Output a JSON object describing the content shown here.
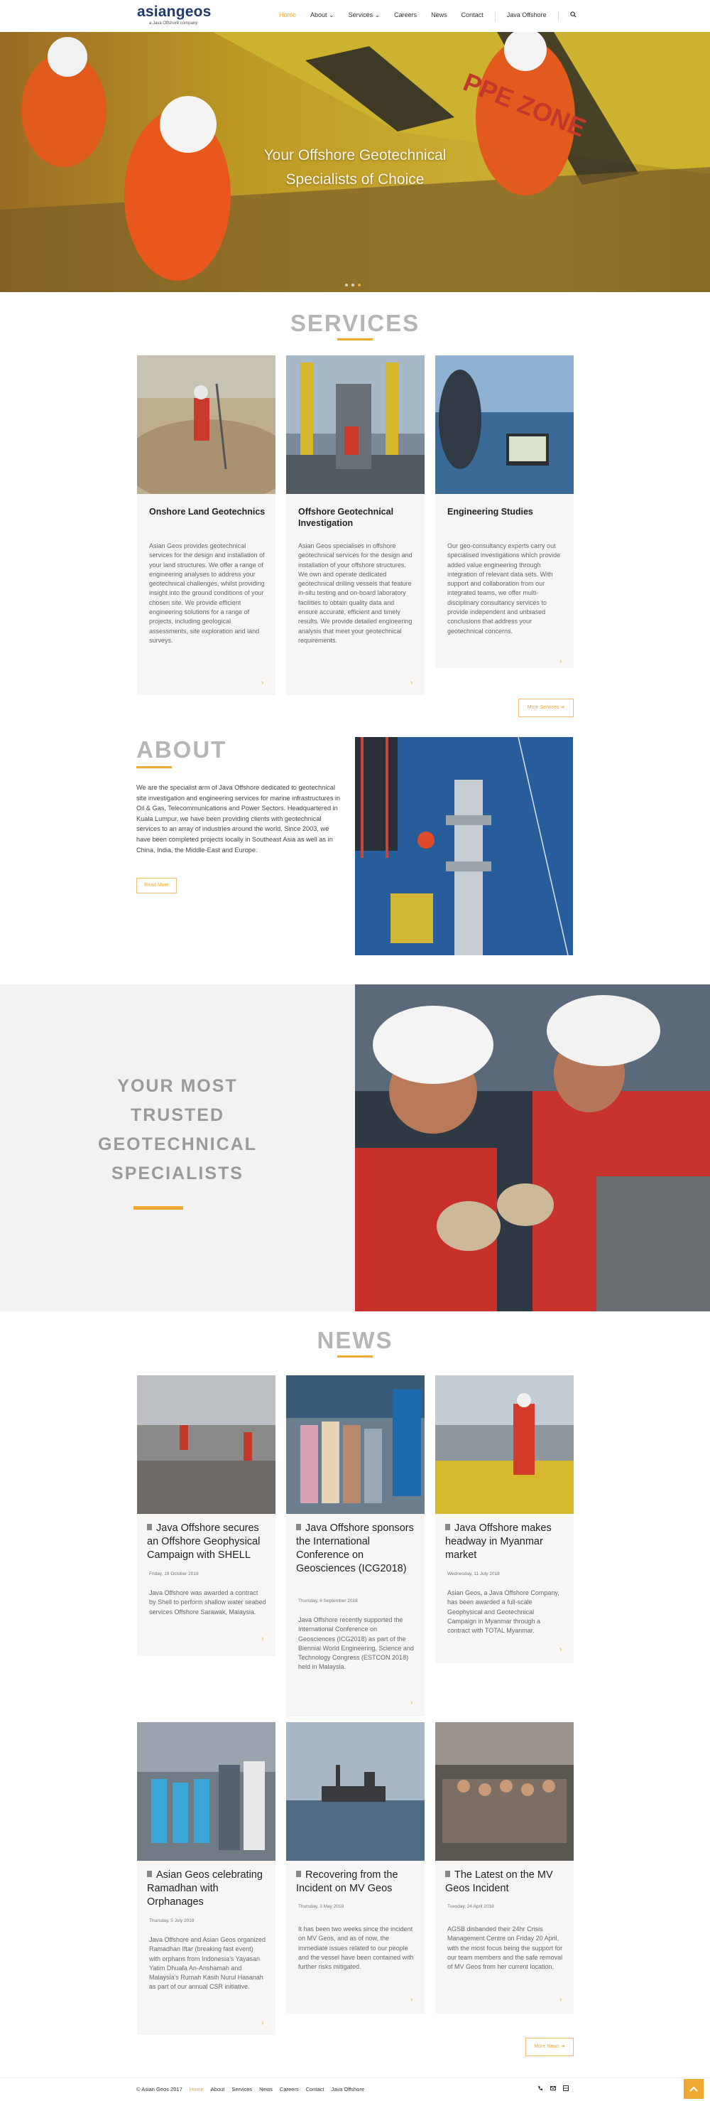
{
  "header": {
    "logo": "asiangeos",
    "tagline": "a Java Offshore company",
    "nav": [
      {
        "label": "Home"
      },
      {
        "label": "About ⌄"
      },
      {
        "label": "Services ⌄"
      },
      {
        "label": "Careers"
      },
      {
        "label": "News"
      },
      {
        "label": "Contact"
      },
      {
        "label": "Java Offshore"
      }
    ],
    "search_icon": "search-icon"
  },
  "hero": {
    "title_line1": "Your Offshore Geotechnical",
    "title_line2": "Specialists of Choice"
  },
  "services": {
    "title": "SERVICES",
    "cards": [
      {
        "title": "Onshore Land Geotechnics",
        "text": "Asian Geos provides geotechnical services for the design and installation of your land structures. We offer a range of engineering analyses to address your geotechnical challenges, whilst providing insight into the ground conditions of your chosen site. We provide efficient engineering solutions for a range of projects, including geological assessments, site exploration and land surveys."
      },
      {
        "title": "Offshore Geotechnical Investigation",
        "text": "Asian Geos specialises in offshore geotechnical services for the design and installation of your offshore structures. We own and operate dedicated geotechnical drilling vessels that feature in-situ testing and on-board laboratory facilities to obtain quality data and ensure accurate, efficient and timely results. We provide detailed engineering analysis that meet your geotechnical requirements."
      },
      {
        "title": "Engineering Studies",
        "text": "Our geo-consultancy experts carry out specialised investigations which provide added value engineering through integration of relevant data sets. With support and collaboration from our integrated teams, we offer multi-disciplinary consultancy services to provide independent and unbiased conclusions that address your geotechnical concerns."
      }
    ],
    "more_label": "More Services ➔"
  },
  "about": {
    "title": "ABOUT",
    "text": "We are the specialist arm of Java Offshore dedicated to geotechnical site investigation and engineering services for marine infrastructures in Oil & Gas, Telecommunications and Power Sectors. Headquartered in Kuala Lumpur, we have been providing clients with geotechnical services to an array of industries around the world. Since 2003, we have been completed projects locally in Southeast Asia as well as in China, India, the Middle-East and Europe.",
    "read_more": "Read More"
  },
  "trusted": {
    "line1": "YOUR MOST",
    "line2": "TRUSTED",
    "line3": "GEOTECHNICAL",
    "line4": "SPECIALISTS"
  },
  "news": {
    "title": "NEWS",
    "items": [
      {
        "title": "Java Offshore secures an Offshore Geophysical Campaign with SHELL",
        "date": "Friday, 19 October 2018",
        "text": "Java Offshore was awarded a contract by Shell to perform shallow water seabed services Offshore Sarawak, Malaysia."
      },
      {
        "title": "Java Offshore sponsors the International Conference on Geosciences (ICG2018)",
        "date": "Thursday, 6 September 2018",
        "text": "Java Offshore recently supported the International Conference on Geosciences (ICG2018) as part of the Biennial World Engineering, Science and Technology Congress (ESTCON 2018) held in Malaysia."
      },
      {
        "title": "Java Offshore makes headway in Myanmar market",
        "date": "Wednesday, 11 July 2018",
        "text": "Asian Geos, a Java Offshore Company, has been awarded a full-scale Geophysical and Geotechnical Campaign in Myanmar through a contract with TOTAL Myanmar."
      },
      {
        "title": "Asian Geos celebrating Ramadhan with Orphanages",
        "date": "Thursday, 5 July 2018",
        "text": "Java Offshore and Asian Geos organized Ramadhan Iftar (breaking fast event) with orphans from Indonesia's Yayasan Yatim Dhuafa An-Anshamah and Malaysia's Rumah Kasih Nurul Hasanah as part of our annual CSR initiative."
      },
      {
        "title": "Recovering from the Incident on MV Geos",
        "date": "Thursday, 3 May 2018",
        "text": "It has been two weeks since the incident on MV Geos, and as of now, the immediate issues related to our people and the vessel have been contained with further risks mitigated."
      },
      {
        "title": "The Latest on the MV Geos Incident",
        "date": "Tuesday, 24 April 2018",
        "text": "AGSB disbanded their 24hr Crisis Management Centre on Friday 20 April, with the most focus being the support for our team members and the safe removal of MV Geos from her current location."
      }
    ],
    "more_label": "More News ➔"
  },
  "footer": {
    "copyright": "© Asian Geos 2017",
    "links": [
      "Home",
      "About",
      "Services",
      "News",
      "Careers",
      "Contact",
      "Java Offshore"
    ],
    "icons": [
      "phone-icon",
      "email-icon",
      "grid-icon"
    ]
  },
  "colors": {
    "accent": "#f0a830",
    "logo": "#1f3a68",
    "heading_grey": "#b5b5b5"
  }
}
